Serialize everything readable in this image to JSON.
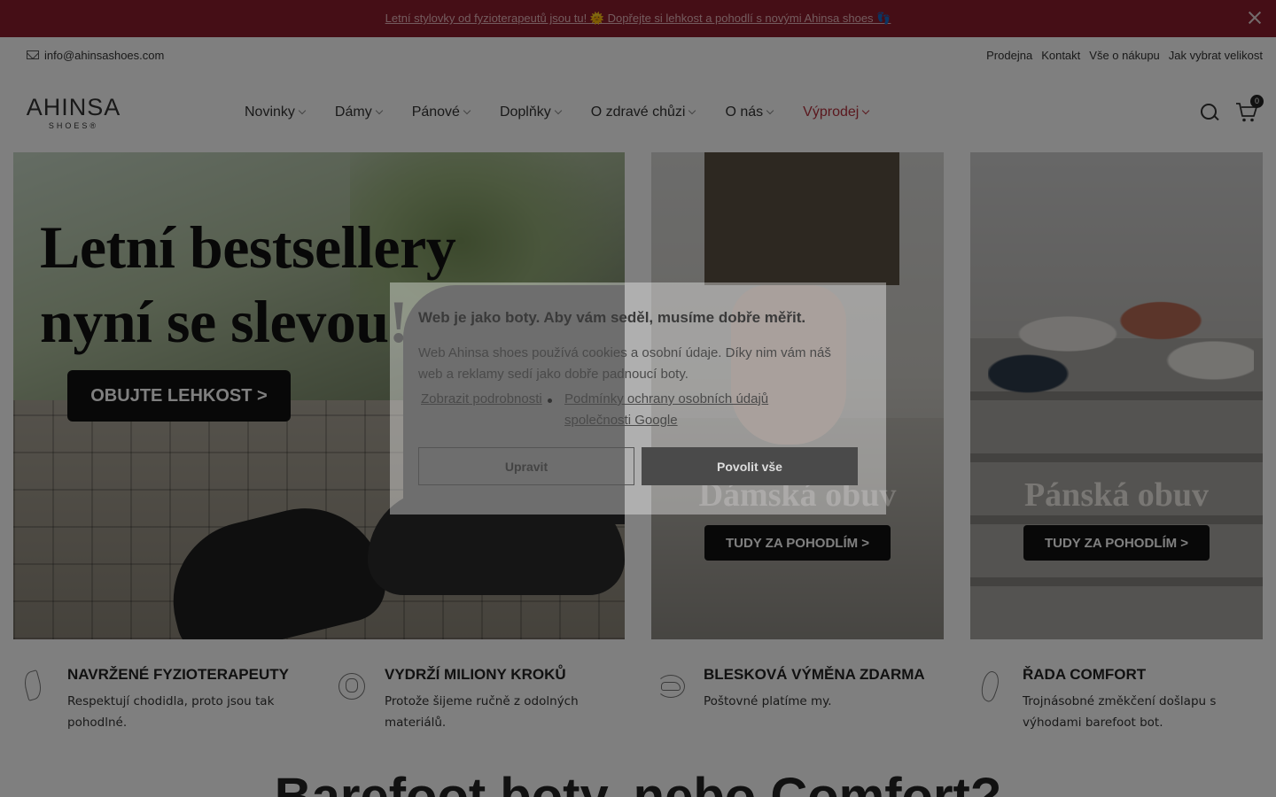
{
  "announcement": {
    "text": "Letní stylovky od fyzioterapeutů jsou tu! 🌞 Dopřejte si lehkost a pohodlí s novými Ahinsa shoes 👣"
  },
  "utility": {
    "email": "info@ahinsashoes.com",
    "links": [
      "Prodejna",
      "Kontakt",
      "Vše o nákupu",
      "Jak vybrat velikost"
    ]
  },
  "header": {
    "logo_word": "AHINSA",
    "logo_sub": "SHOES®",
    "nav": [
      "Novinky",
      "Dámy",
      "Pánové",
      "Doplňky",
      "O zdravé chůzi",
      "O nás",
      "Výprodej"
    ],
    "cart_count": "0"
  },
  "banners": {
    "main": {
      "title_line1": "Letní bestsellery",
      "title_line2": "nyní se slevou!",
      "cta": "OBUJTE LEHKOST >"
    },
    "women": {
      "title": "Dámská obuv",
      "cta": "TUDY ZA POHODLÍM  >"
    },
    "men": {
      "title": "Pánská obuv",
      "cta": "TUDY ZA POHODLÍM  >"
    }
  },
  "features": [
    {
      "title": "NAVRŽENÉ FYZIOTERAPEUTY",
      "text": "Respektují chodidla, proto jsou tak pohodlné.",
      "icon": "leaf-icon"
    },
    {
      "title": "VYDRŽÍ MILIONY KROKŮ",
      "text": "Protože šijeme ručně z odolných materiálů.",
      "icon": "globe-icon"
    },
    {
      "title": "BLESKOVÁ VÝMĚNA ZDARMA",
      "text": "Poštovné platíme my.",
      "icon": "swap-shoe-icon"
    },
    {
      "title": "ŘADA COMFORT",
      "text": "Trojnásobné změkčení došlapu s výhodami barefoot bot.",
      "icon": "foot-icon"
    }
  ],
  "section_title": "Barefoot boty, nebo Comfort?",
  "cookie": {
    "title": "Web je jako boty. Aby vám seděl, musíme dobře měřit.",
    "text": "Web Ahinsa shoes používá cookies a osobní údaje. Díky nim vám náš web a reklamy sedí jako dobře padnoucí boty.",
    "link_details": "Zobrazit podrobnosti",
    "link_google": "Podmínky ochrany osobních údajů společnosti Google",
    "edit_label": "Upravit",
    "accept_label": "Povolit vše"
  },
  "colors": {
    "announcement_bg": "#8a1d2c",
    "sale": "#b5303d"
  }
}
